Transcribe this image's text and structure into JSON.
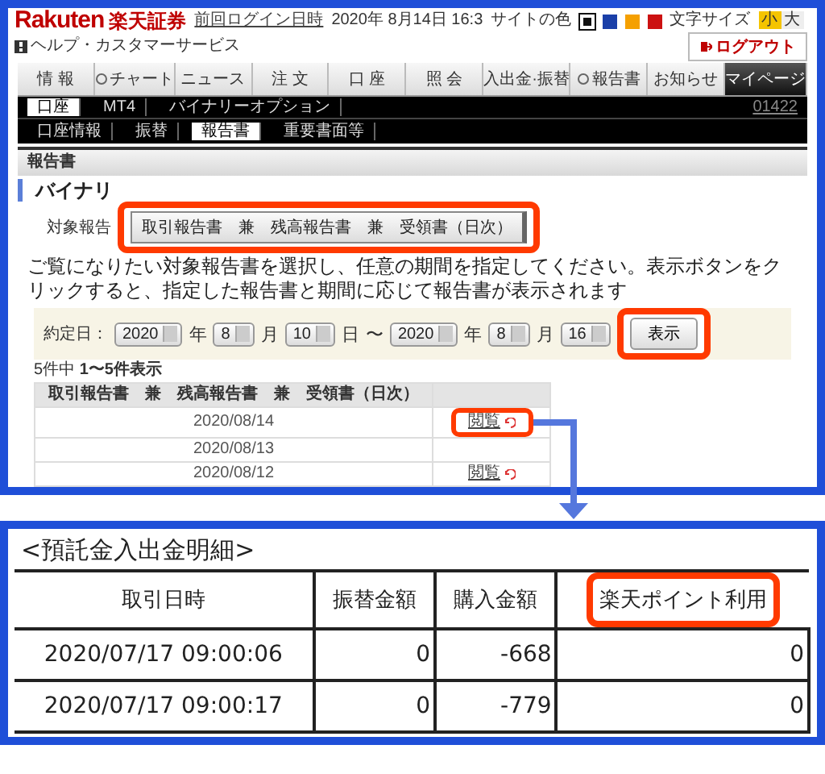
{
  "header": {
    "logo": "Rakuten",
    "logo_jp": "楽天証券",
    "last_login_label": "前回ログイン日時",
    "last_login": "2020年 8月14日 16:3",
    "site_color_label": "サイトの色",
    "site_colors": [
      {
        "color": "#111111",
        "selected": true
      },
      {
        "color": "#1a3fa8",
        "selected": false
      },
      {
        "color": "#f5a000",
        "selected": false
      },
      {
        "color": "#cc1111",
        "selected": false
      }
    ],
    "font_size_label": "文字サイズ",
    "font_sizes": [
      {
        "label": "小",
        "selected": true
      },
      {
        "label": "大",
        "selected": false
      }
    ],
    "help": "ヘルプ・カスタマーサービス",
    "logout": "ログアウト"
  },
  "nav": [
    {
      "label": "情 報",
      "icon": false,
      "selected": false
    },
    {
      "label": "チャート",
      "icon": true,
      "selected": false
    },
    {
      "label": "ニュース",
      "icon": false,
      "selected": false
    },
    {
      "label": "注 文",
      "icon": false,
      "selected": false
    },
    {
      "label": "口 座",
      "icon": false,
      "selected": false
    },
    {
      "label": "照 会",
      "icon": false,
      "selected": false
    },
    {
      "label": "入出金·振替",
      "icon": false,
      "selected": false
    },
    {
      "label": "報告書",
      "icon": true,
      "selected": false
    },
    {
      "label": "お知らせ",
      "icon": false,
      "selected": false
    },
    {
      "label": "マイページ",
      "icon": false,
      "selected": true
    }
  ],
  "subnav": {
    "items": [
      {
        "label": "口座",
        "selected": true
      },
      {
        "label": "MT4",
        "selected": false
      },
      {
        "label": "バイナリーオプション",
        "selected": false
      }
    ],
    "account": "01422"
  },
  "subnav2": [
    {
      "label": "口座情報",
      "selected": false
    },
    {
      "label": "振替",
      "selected": false
    },
    {
      "label": "報告書",
      "selected": true
    },
    {
      "label": "重要書面等",
      "selected": false
    }
  ],
  "section_title": "報告書",
  "page_title": "バイナリ",
  "report_select": {
    "label": "対象報告",
    "value": "取引報告書　兼　残高報告書　兼　受領書（日次）",
    "highlighted": true
  },
  "instructions": "ご覧になりたい対象報告書を選択し、任意の期間を指定してください。表示ボタンをクリックすると、指定した報告書と期間に応じて報告書が表示されます",
  "date_filter": {
    "label": "約定日：",
    "from": [
      {
        "value": "2020",
        "unit": "年"
      },
      {
        "value": "8",
        "unit": "月"
      },
      {
        "value": "10",
        "unit": "日"
      }
    ],
    "separator": "〜",
    "to": [
      {
        "value": "2020",
        "unit": "年"
      },
      {
        "value": "8",
        "unit": "月"
      },
      {
        "value": "16"
      }
    ],
    "button": {
      "label": "表示",
      "highlighted": true
    }
  },
  "result_count": "5件中 **1〜5件表示**",
  "report_table": {
    "columns": [
      "取引報告書　兼　残高報告書　兼　受領書（日次）"
    ],
    "rows": [
      {
        "date": "2020/08/14",
        "link": "閲覧",
        "highlighted": true
      },
      {
        "date": "2020/08/13"
      },
      {
        "date": "2020/08/12",
        "link": "閲覧",
        "highlighted": false
      }
    ]
  },
  "detail": {
    "title": "<預託金入出金明細>",
    "columns": [
      {
        "label": "取引日時",
        "highlighted": false
      },
      {
        "label": "振替金額",
        "highlighted": false
      },
      {
        "label": "購入金額",
        "highlighted": false
      },
      {
        "label": "楽天ポイント利用",
        "highlighted": true
      }
    ],
    "rows": [
      [
        "2020/07/17 09:00:06",
        "0",
        "-668",
        "0"
      ],
      [
        "2020/07/17 09:00:17",
        "0",
        "-779",
        "0"
      ]
    ]
  }
}
